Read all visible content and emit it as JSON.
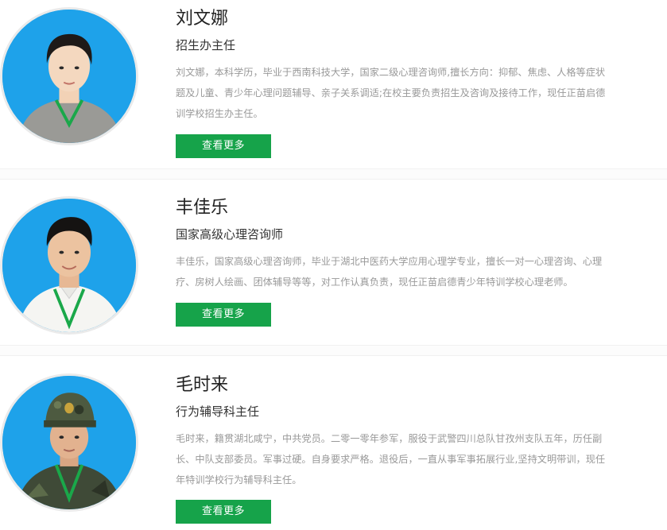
{
  "staff": [
    {
      "name": "刘文娜",
      "title": "招生办主任",
      "desc_lines": [
        "刘文娜，本科学历，毕业于西南科技大学，国家二级心理咨询师,擅长方向：抑郁、焦虑、人格等症状",
        "题及儿童、青少年心理问题辅导、亲子关系调适;在校主要负责招生及咨询及接待工作，现任正苗启德",
        "训学校招生办主任。"
      ],
      "button_label": "查看更多"
    },
    {
      "name": "丰佳乐",
      "title": "国家高级心理咨询师",
      "desc_lines": [
        "丰佳乐，国家高级心理咨询师，毕业于湖北中医药大学应用心理学专业，擅长一对一心理咨询、心理",
        "疗、房树人绘画、团体辅导等等，对工作认真负责，现任正苗启德青少年特训学校心理老师。"
      ],
      "button_label": "查看更多"
    },
    {
      "name": "毛时来",
      "title": "行为辅导科主任",
      "desc_lines": [
        "毛时来，籍贯湖北咸宁，中共党员。二零一零年参军，服役于武警四川总队甘孜州支队五年，历任副",
        "长、中队支部委员。军事过硬。自身要求严格。退役后，一直从事军事拓展行业,坚持文明带训，现任",
        "年特训学校行为辅导科主任。"
      ],
      "button_label": "查看更多"
    }
  ],
  "colors": {
    "button_bg": "#16a34a",
    "photo_bg": "#1aa0e8",
    "name_text": "#222222",
    "desc_text": "#999999"
  }
}
